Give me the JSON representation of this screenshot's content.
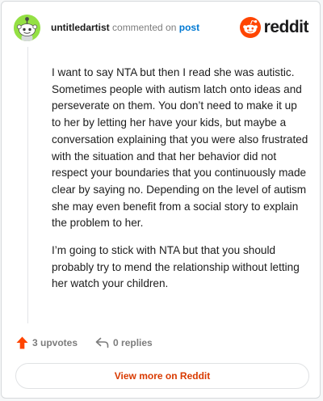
{
  "comment": {
    "username": "untitledartist",
    "action_text": "commented on",
    "post_link": "post",
    "paragraphs": [
      "I want to say NTA but then I read she was autistic. Sometimes people with autism latch onto ideas and perseverate on them. You don’t need to make it up to her by letting her have your kids, but maybe a conversation explaining that you were also frustrated with the situation and that her behavior did not respect your boundaries that you continuously made clear by saying no. Depending on the level of autism she may even benefit from a social story to explain the problem to her.",
      "I’m going to stick with NTA but that you should probably try to mend the relationship without letting her watch your children."
    ],
    "upvotes_label": "3 upvotes",
    "replies_label": "0 replies"
  },
  "brand": {
    "name": "reddit",
    "color": "#ff4500"
  },
  "footer": {
    "view_more_label": "View more on Reddit"
  },
  "colors": {
    "accent": "#d93a00",
    "link": "#0079d3",
    "avatar_bg": "#94e044"
  }
}
